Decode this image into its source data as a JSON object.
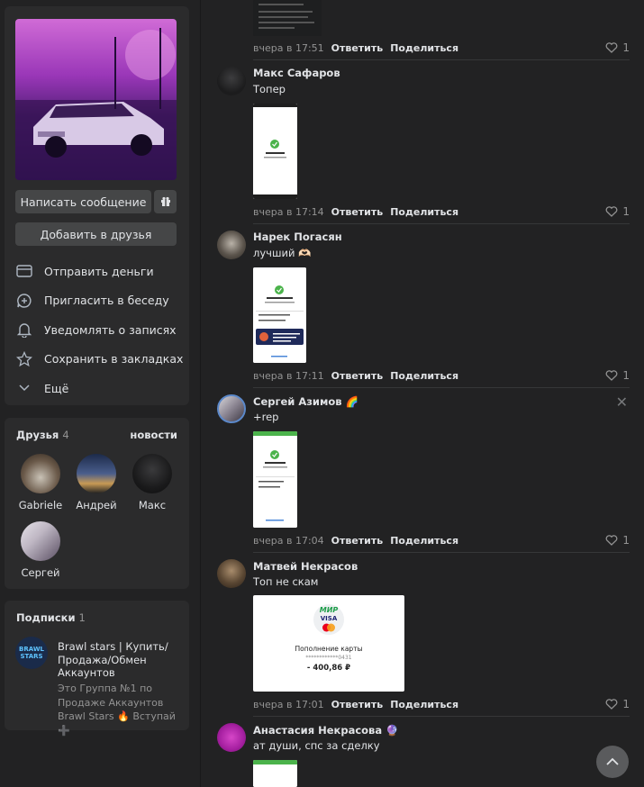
{
  "profile": {
    "message_button": "Написать сообщение",
    "add_friend_button": "Добавить в друзья",
    "menu": [
      {
        "label": "Отправить деньги",
        "icon": "money-card-icon"
      },
      {
        "label": "Пригласить в беседу",
        "icon": "chat-plus-icon"
      },
      {
        "label": "Уведомлять о записях",
        "icon": "bell-icon"
      },
      {
        "label": "Сохранить в закладках",
        "icon": "star-icon"
      },
      {
        "label": "Ещё",
        "icon": "chevron-down-icon"
      }
    ]
  },
  "friends": {
    "title": "Друзья",
    "count": "4",
    "link": "новости",
    "items": [
      {
        "name": "Gabriele"
      },
      {
        "name": "Андрей"
      },
      {
        "name": "Макс"
      },
      {
        "name": "Сергей"
      }
    ]
  },
  "subscriptions": {
    "title": "Подписки",
    "count": "1",
    "item": {
      "logo_text": "BRAWL STARS",
      "name": "Brawl stars | Купить/Продажа/Обмен Аккаунтов",
      "desc": "Это Группа №1 по Продаже Аккаунтов Brawl Stars 🔥 Вступай ➕"
    }
  },
  "comments": [
    {
      "time": "вчера в 17:51",
      "reply": "Ответить",
      "share": "Поделиться",
      "likes": "1"
    },
    {
      "name": "Макс Сафаров",
      "text": "Топер",
      "time": "вчера в 17:14",
      "reply": "Ответить",
      "share": "Поделиться",
      "likes": "1",
      "receipt": {
        "title": "Платеж отправлен"
      }
    },
    {
      "name": "Нарек Погасян",
      "text": "лучший 🫶🏻",
      "time": "вчера в 17:11",
      "reply": "Ответить",
      "share": "Поделиться",
      "likes": "1",
      "receipt": {
        "title": "Платеж отправлен"
      }
    },
    {
      "name": "Сергей Азимов 🌈",
      "text": "+rep",
      "time": "вчера в 17:04",
      "reply": "Ответить",
      "share": "Поделиться",
      "likes": "1",
      "receipt": {
        "title": "Платеж отправлен"
      }
    },
    {
      "name": "Матвей Некрасов",
      "text": "Топ не скам",
      "time": "вчера в 17:01",
      "reply": "Ответить",
      "share": "Поделиться",
      "likes": "1",
      "card": {
        "brand": "МИР",
        "visa": "VISA",
        "title": "Пополнение карты",
        "masked": "************0431",
        "amount": "- 400,86 ₽"
      }
    },
    {
      "name": "Анастасия Некрасова 🔮",
      "text": "ат души, спс за сделку"
    }
  ],
  "colors": {
    "accent_green": "#4bb34b",
    "card_bg": "#2b2b2c",
    "page_bg": "#222223",
    "muted": "#939393"
  }
}
